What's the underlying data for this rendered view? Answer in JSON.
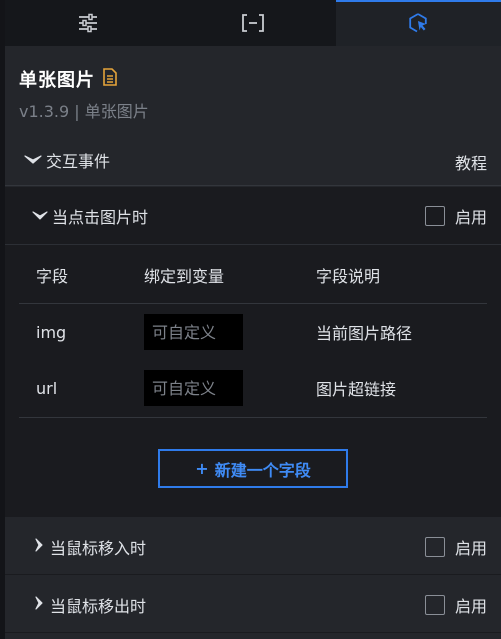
{
  "tabs": [
    {
      "icon": "sliders-icon",
      "active": false
    },
    {
      "icon": "bracket-box-icon",
      "active": false
    },
    {
      "icon": "cursor-click-icon",
      "active": true
    }
  ],
  "header": {
    "title": "单张图片",
    "version": "v1.3.9 | 单张图片"
  },
  "interaction": {
    "section_label": "交互事件",
    "tutorial_label": "教程",
    "on_click": {
      "title": "当点击图片时",
      "enable_label": "启用",
      "enabled": false,
      "columns": [
        "字段",
        "绑定到变量",
        "字段说明"
      ],
      "rows": [
        {
          "field": "img",
          "placeholder": "可自定义",
          "value": "",
          "desc": "当前图片路径"
        },
        {
          "field": "url",
          "placeholder": "可自定义",
          "value": "",
          "desc": "图片超链接"
        }
      ],
      "add_button_label": "新建一个字段"
    },
    "on_mouse_enter": {
      "title": "当鼠标移入时",
      "enable_label": "启用",
      "enabled": false
    },
    "on_mouse_leave": {
      "title": "当鼠标移出时",
      "enable_label": "启用",
      "enabled": false
    }
  },
  "colors": {
    "accent": "#2f7bea",
    "doc_icon": "#e5a43a",
    "background": "#24262b",
    "panel": "#1a1b1f"
  }
}
